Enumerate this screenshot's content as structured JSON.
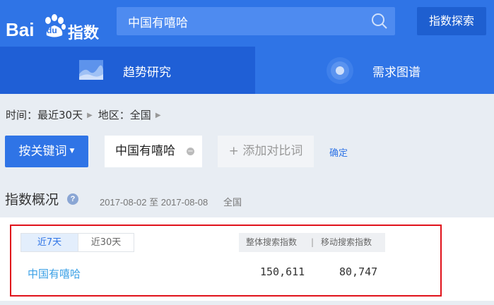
{
  "header": {
    "logo_text_bai": "Bai",
    "logo_text_du": "du",
    "logo_text_zhishu": "指数",
    "search_value": "中国有嘻哈",
    "search_icon": "magnifier-icon",
    "explore_label": "指数探索"
  },
  "tabs": [
    {
      "label": "趋势研究",
      "active": true,
      "icon": "trend-chart-icon"
    },
    {
      "label": "需求图谱",
      "active": false,
      "icon": "target-icon"
    }
  ],
  "filters": {
    "time": "时间：最近30天",
    "region": "地区：全国"
  },
  "keyword_bar": {
    "by_keyword_label": "按关键词",
    "chip_label": "中国有嘻哈",
    "add_compare_label": "添加对比词",
    "confirm_label": "确定"
  },
  "overview": {
    "title": "指数概况",
    "date_range": "2017-08-02 至 2017-08-08",
    "region": "全国",
    "range_options": [
      "近7天",
      "近30天"
    ],
    "selected_range": "近7天",
    "col_overall": "整体搜索指数",
    "col_sep": "|",
    "col_mobile": "移动搜索指数",
    "rows": [
      {
        "keyword": "中国有嘻哈",
        "overall": "150,611",
        "mobile": "80,747"
      }
    ]
  },
  "colors": {
    "brand_blue": "#2f74e6",
    "highlight_red": "#e0121b"
  }
}
